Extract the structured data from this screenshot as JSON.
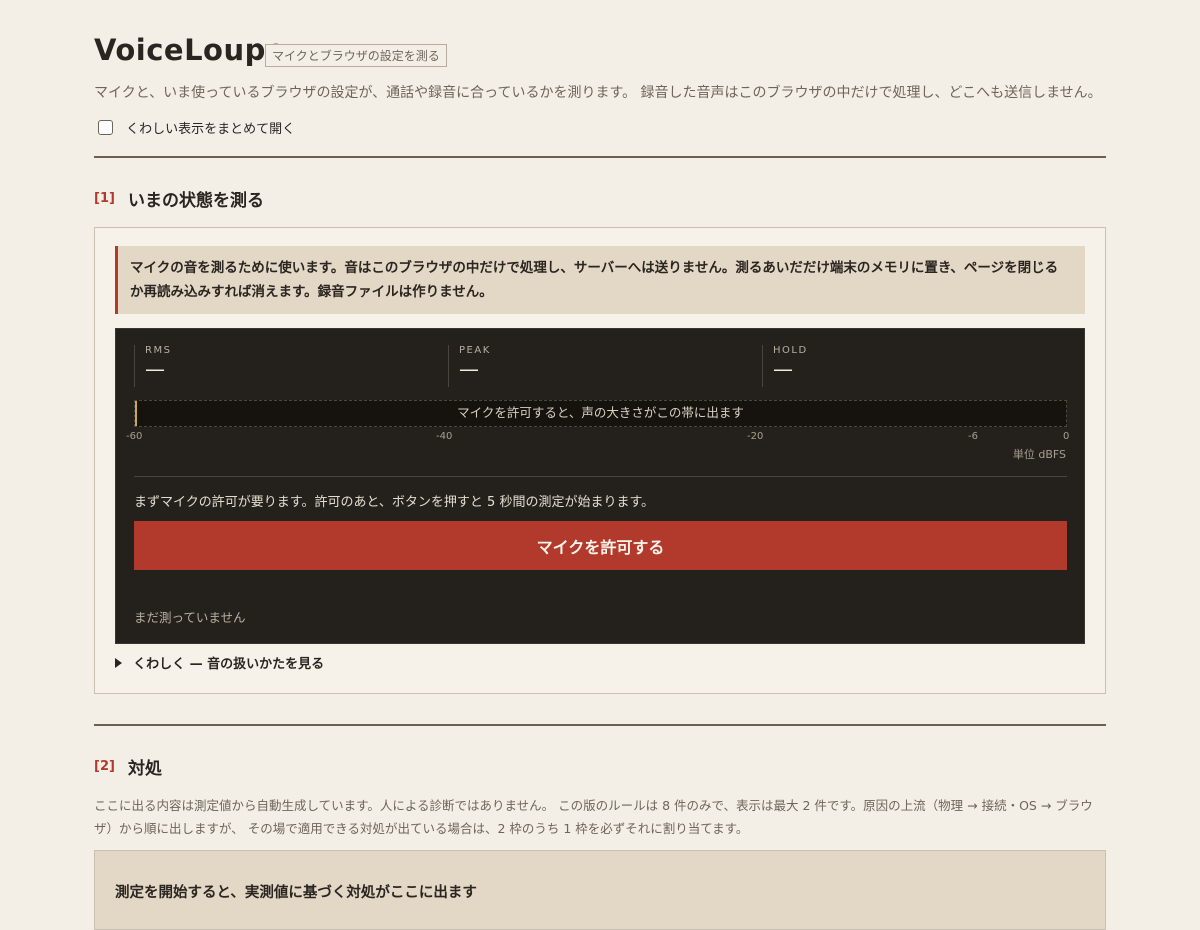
{
  "header": {
    "title": "VoiceLoupe",
    "badge": "マイクとブラウザの設定を測る",
    "description": "マイクと、いま使っているブラウザの設定が、通話や録音に合っているかを測ります。 録音した音声はこのブラウザの中だけで処理し、どこへも送信しません。",
    "expand_all_label": "くわしい表示をまとめて開く",
    "expand_all_checked": false
  },
  "section1": {
    "number": "[1]",
    "title": "いまの状態を測る",
    "notice": "マイクの音を測るために使います。音はこのブラウザの中だけで処理し、サーバーへは送りません。測るあいだだけ端末のメモリに置き、ページを閉じるか再読み込みすれば消えます。録音ファイルは作りません。",
    "meter": {
      "stats": [
        {
          "label": "RMS",
          "value": "—"
        },
        {
          "label": "PEAK",
          "value": "—"
        },
        {
          "label": "HOLD",
          "value": "—"
        }
      ],
      "band_hint": "マイクを許可すると、声の大きさがこの帯に出ます",
      "scale_ticks": [
        "-60",
        "-40",
        "-20",
        "-6",
        "0"
      ],
      "unit": "単位 dBFS",
      "instruction": "まずマイクの許可が要ります。許可のあと、ボタンを押すと 5 秒間の測定が始まります。",
      "allow_button": "マイクを許可する",
      "status": "まだ測っていません"
    },
    "details_label": "くわしく — 音の扱いかたを見る"
  },
  "section2": {
    "number": "[2]",
    "title": "対処",
    "description": "ここに出る内容は測定値から自動生成しています。人による診断ではありません。 この版のルールは 8 件のみで、表示は最大 2 件です。原因の上流（物理 → 接続・OS → ブラウザ）から順に出しますが、 その場で適用できる対処が出ている場合は、2 枠のうち 1 枠を必ずそれに割り当てます。",
    "card_title": "測定を開始すると、実測値に基づく対処がここに出ます"
  },
  "colors": {
    "accent": "#b23a2c",
    "background": "#f4efe6",
    "meter_bg": "#24211d",
    "notice_bg": "#e3d8c5"
  }
}
